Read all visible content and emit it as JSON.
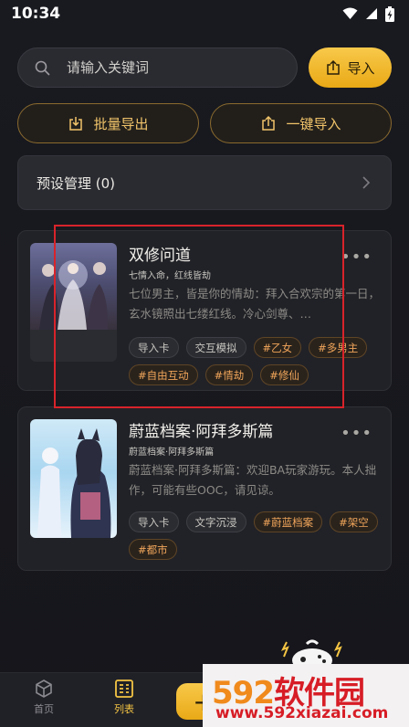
{
  "status": {
    "time": "10:34"
  },
  "search": {
    "placeholder": "请输入关键词"
  },
  "actions": {
    "import_label": "导入",
    "batch_export_label": "批量导出",
    "one_click_import_label": "一键导入"
  },
  "preset": {
    "label": "预设管理 (0)"
  },
  "cards": [
    {
      "title": "双修问道",
      "subtitle": "七情入命，红线皆劫",
      "description": "七位男主，皆是你的情劫：拜入合欢宗的第一日，玄水镜照出七缕红线。冷心剑尊、…",
      "tags": [
        "导入卡",
        "交互模拟",
        "#乙女",
        "#多男主",
        "#自由互动",
        "#情劫",
        "#修仙"
      ]
    },
    {
      "title": "蔚蓝档案·阿拜多斯篇",
      "subtitle": "蔚蓝档案·阿拜多斯篇",
      "description": "蔚蓝档案·阿拜多斯篇：欢迎BA玩家游玩。本人拙作，可能有些OOC，请见谅。",
      "tags": [
        "导入卡",
        "文字沉浸",
        "#蔚蓝档案",
        "#架空",
        "#都市"
      ]
    }
  ],
  "nav": {
    "home_label": "首页",
    "list_label": "列表",
    "fab_label": "+"
  },
  "watermark": {
    "logo_digits": "592",
    "logo_text": "软件园",
    "url": "www.592xiazai.com"
  },
  "colors": {
    "accent": "#f4c443",
    "tag_gold": "#f0a55a",
    "highlight": "#d8232a"
  }
}
